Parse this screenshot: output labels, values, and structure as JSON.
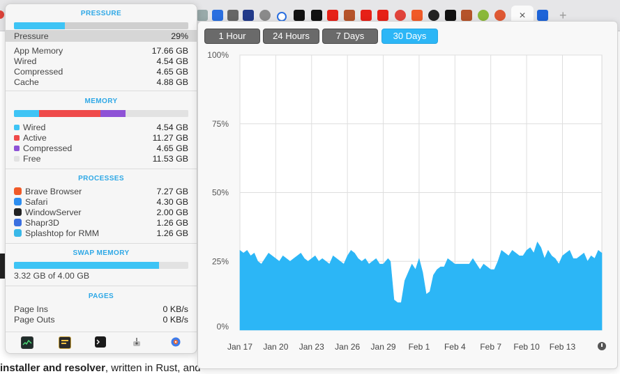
{
  "background": {
    "page_text_bold": "installer and resolver",
    "page_text_rest": ", written in Rust, and",
    "active_tab_close": "×",
    "new_tab": "+"
  },
  "stats": {
    "pressure": {
      "title": "PRESSURE",
      "bar_fraction": 0.29,
      "label": "Pressure",
      "value": "29%",
      "rows": [
        {
          "label": "App Memory",
          "value": "17.66 GB"
        },
        {
          "label": "Wired",
          "value": "4.54 GB"
        },
        {
          "label": "Compressed",
          "value": "4.65 GB"
        },
        {
          "label": "Cache",
          "value": "4.88 GB"
        }
      ]
    },
    "memory": {
      "title": "MEMORY",
      "rows": [
        {
          "label": "Wired",
          "value": "4.54 GB",
          "color": "#3ec4f5"
        },
        {
          "label": "Active",
          "value": "11.27 GB",
          "color": "#ef4a4a"
        },
        {
          "label": "Compressed",
          "value": "4.65 GB",
          "color": "#8e52d6"
        },
        {
          "label": "Free",
          "value": "11.53 GB",
          "color": "#e2e2e2"
        }
      ],
      "bar_fractions": [
        0.142,
        0.352,
        0.146,
        0.36
      ]
    },
    "processes": {
      "title": "PROCESSES",
      "rows": [
        {
          "label": "Brave Browser",
          "value": "7.27 GB",
          "icon": "brave-icon",
          "color": "#f05a28"
        },
        {
          "label": "Safari",
          "value": "4.30 GB",
          "icon": "safari-icon",
          "color": "#2d8ef0"
        },
        {
          "label": "WindowServer",
          "value": "2.00 GB",
          "icon": "windowserver-icon",
          "color": "#222222"
        },
        {
          "label": "Shapr3D",
          "value": "1.26 GB",
          "icon": "shapr3d-icon",
          "color": "#3a6fe0"
        },
        {
          "label": "Splashtop for RMM",
          "value": "1.26 GB",
          "icon": "splashtop-icon",
          "color": "#39b8e8"
        }
      ]
    },
    "swap": {
      "title": "SWAP MEMORY",
      "bar_fraction": 0.83,
      "summary": "3.32 GB of 4.00 GB"
    },
    "pages": {
      "title": "PAGES",
      "rows": [
        {
          "label": "Page Ins",
          "value": "0 KB/s"
        },
        {
          "label": "Page Outs",
          "value": "0 KB/s"
        }
      ]
    },
    "dock_icons": [
      "activity-monitor-icon",
      "console-icon",
      "terminal-icon",
      "system-info-icon",
      "disk-utility-icon"
    ]
  },
  "range_buttons": [
    {
      "label": "1 Hour",
      "active": false
    },
    {
      "label": "24 Hours",
      "active": false
    },
    {
      "label": "7 Days",
      "active": false
    },
    {
      "label": "30 Days",
      "active": true
    }
  ],
  "chart_data": {
    "type": "area",
    "title": "",
    "xlabel": "",
    "ylabel": "",
    "ylim": [
      0,
      100
    ],
    "y_ticks": [
      "0%",
      "25%",
      "50%",
      "75%",
      "100%"
    ],
    "x_ticks": [
      "Jan 17",
      "Jan 20",
      "Jan 23",
      "Jan 26",
      "Jan 29",
      "Feb 1",
      "Feb 4",
      "Feb 7",
      "Feb 10",
      "Feb 13"
    ],
    "x_range_days": [
      0,
      30.3
    ],
    "grid": true,
    "series": [
      {
        "color": "#2cb6f6",
        "x": [
          0,
          0.3,
          0.6,
          0.9,
          1.2,
          1.5,
          1.8,
          2.1,
          2.4,
          2.7,
          3.0,
          3.3,
          3.6,
          3.9,
          4.2,
          4.5,
          4.8,
          5.1,
          5.4,
          5.7,
          6.0,
          6.3,
          6.6,
          6.9,
          7.2,
          7.5,
          7.8,
          8.1,
          8.4,
          8.7,
          9.0,
          9.3,
          9.6,
          9.9,
          10.2,
          10.5,
          10.8,
          11.1,
          11.4,
          11.7,
          12.0,
          12.2,
          12.4,
          12.6,
          12.9,
          13.2,
          13.5,
          13.8,
          14.1,
          14.4,
          14.7,
          15.0,
          15.3,
          15.6,
          15.9,
          16.2,
          16.5,
          16.8,
          17.1,
          17.4,
          17.7,
          18.0,
          18.3,
          18.6,
          18.9,
          19.2,
          19.5,
          19.8,
          20.1,
          20.4,
          20.7,
          21.0,
          21.3,
          21.6,
          21.9,
          22.2,
          22.5,
          22.8,
          23.1,
          23.4,
          23.7,
          24.0,
          24.3,
          24.6,
          24.9,
          25.2,
          25.5,
          25.8,
          26.1,
          26.4,
          26.7,
          27.0,
          27.3,
          27.6,
          27.9,
          28.2,
          28.5,
          28.8,
          29.1,
          29.4,
          29.7,
          30.0,
          30.3
        ],
        "values": [
          29,
          28,
          29,
          27,
          28,
          25,
          24,
          26,
          28,
          27,
          26,
          25,
          27,
          26,
          25,
          26,
          27,
          28,
          26,
          25,
          26,
          27,
          25,
          26,
          25,
          24,
          27,
          26,
          25,
          24,
          27,
          29,
          28,
          26,
          25,
          26,
          24,
          25,
          26,
          24,
          24,
          25,
          26,
          25,
          11,
          10,
          10,
          18,
          21,
          24,
          22,
          26,
          21,
          13,
          14,
          20,
          22,
          23,
          23,
          26,
          25,
          24,
          24,
          24,
          24,
          24,
          26,
          24,
          22,
          24,
          23,
          22,
          22,
          25,
          29,
          28,
          27,
          29,
          28,
          27,
          27,
          29,
          30,
          28,
          32,
          30,
          26,
          29,
          27,
          26,
          24,
          27,
          28,
          29,
          26,
          26,
          27,
          28,
          25,
          27,
          26,
          29,
          28
        ]
      }
    ]
  }
}
